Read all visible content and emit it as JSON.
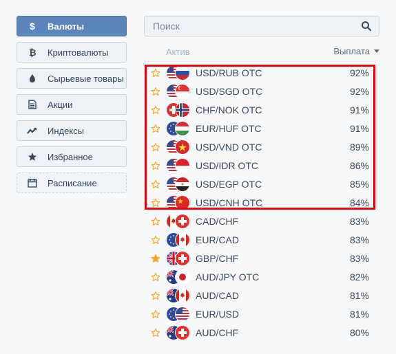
{
  "sidebar": {
    "items": [
      {
        "label": "Валюты",
        "icon": "dollar-icon",
        "active": true
      },
      {
        "label": "Криптовалюты",
        "icon": "bitcoin-icon"
      },
      {
        "label": "Сырьевые товары",
        "icon": "drop-icon"
      },
      {
        "label": "Акции",
        "icon": "document-icon"
      },
      {
        "label": "Индексы",
        "icon": "trend-icon"
      },
      {
        "label": "Избранное",
        "icon": "star-icon"
      },
      {
        "label": "Расписание",
        "icon": "calendar-icon"
      }
    ]
  },
  "search": {
    "placeholder": "Поиск"
  },
  "header": {
    "asset": "Актив",
    "payout": "Выплата"
  },
  "assets": [
    {
      "name": "USD/RUB OTC",
      "payout": "92%",
      "favorite": false
    },
    {
      "name": "USD/SGD OTC",
      "payout": "92%",
      "favorite": false
    },
    {
      "name": "CHF/NOK OTC",
      "payout": "91%",
      "favorite": false
    },
    {
      "name": "EUR/HUF OTC",
      "payout": "91%",
      "favorite": false
    },
    {
      "name": "USD/VND OTC",
      "payout": "89%",
      "favorite": false
    },
    {
      "name": "USD/IDR OTC",
      "payout": "86%",
      "favorite": false
    },
    {
      "name": "USD/EGP OTC",
      "payout": "85%",
      "favorite": false
    },
    {
      "name": "USD/CNH OTC",
      "payout": "84%",
      "favorite": false
    },
    {
      "name": "CAD/CHF",
      "payout": "83%",
      "favorite": false
    },
    {
      "name": "EUR/CAD",
      "payout": "83%",
      "favorite": false
    },
    {
      "name": "GBP/CHF",
      "payout": "83%",
      "favorite": true
    },
    {
      "name": "AUD/JPY OTC",
      "payout": "82%",
      "favorite": false
    },
    {
      "name": "AUD/CAD",
      "payout": "81%",
      "favorite": false
    },
    {
      "name": "EUR/USD",
      "payout": "81%",
      "favorite": false
    },
    {
      "name": "AUD/CHF",
      "payout": "80%",
      "favorite": false
    }
  ],
  "colors": {
    "accent": "#5b86bd",
    "star": "#f5a623",
    "highlight": "#e3000f"
  }
}
